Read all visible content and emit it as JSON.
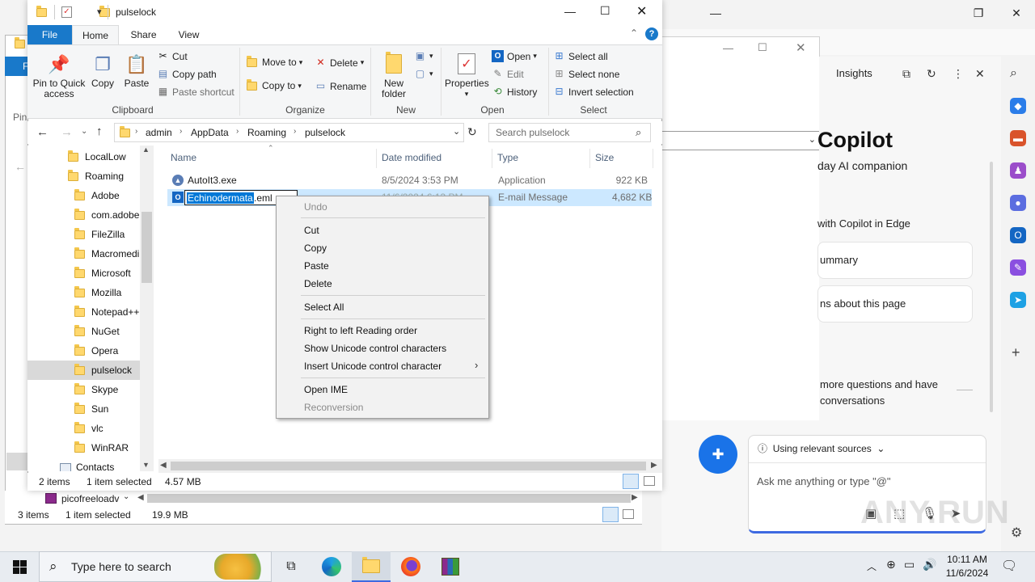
{
  "edge": {
    "copilot": {
      "tab_label": "Insights",
      "heading": "Copilot",
      "subheading": "day AI companion",
      "line1": "with Copilot in Edge",
      "card1": "ummary",
      "card2": "ns about this page",
      "more_line1": "more questions and have",
      "more_line2": "conversations",
      "sources_label": "Using relevant sources",
      "input_placeholder": "Ask me anything or type \"@\""
    }
  },
  "bg_window": {
    "status_items": "3 items",
    "status_selected": "1 item selected",
    "status_size": "19.9 MB",
    "nav_item": "picofreeloadv",
    "nav_left": "Pin",
    "ribbon_file": "F"
  },
  "explorer": {
    "title": "pulselock",
    "tabs": [
      "File",
      "Home",
      "Share",
      "View"
    ],
    "ribbon": {
      "clipboard": {
        "pin": "Pin to Quick access",
        "copy": "Copy",
        "paste": "Paste",
        "cut": "Cut",
        "copy_path": "Copy path",
        "paste_shortcut": "Paste shortcut",
        "label": "Clipboard"
      },
      "organize": {
        "move_to": "Move to",
        "copy_to": "Copy to",
        "delete": "Delete",
        "rename": "Rename",
        "label": "Organize"
      },
      "new": {
        "new_folder": "New folder",
        "label": "New"
      },
      "open": {
        "properties": "Properties",
        "open": "Open",
        "edit": "Edit",
        "history": "History",
        "label": "Open"
      },
      "select": {
        "select_all": "Select all",
        "select_none": "Select none",
        "invert": "Invert selection",
        "label": "Select"
      }
    },
    "breadcrumb": [
      "admin",
      "AppData",
      "Roaming",
      "pulselock"
    ],
    "search_placeholder": "Search pulselock",
    "nav_items": [
      "LocalLow",
      "Roaming",
      "Adobe",
      "com.adobe.",
      "FileZilla",
      "Macromedi",
      "Microsoft",
      "Mozilla",
      "Notepad++",
      "NuGet",
      "Opera",
      "pulselock",
      "Skype",
      "Sun",
      "vlc",
      "WinRAR",
      "Contacts"
    ],
    "columns": [
      "Name",
      "Date modified",
      "Type",
      "Size"
    ],
    "files": [
      {
        "name": "AutoIt3.exe",
        "date": "8/5/2024 3:53 PM",
        "type": "Application",
        "size": "922 KB"
      },
      {
        "name_selected": "Echinodermata",
        "name_ext": ".eml",
        "date": "11/6/2024 6:13 PM",
        "type": "E-mail Message",
        "size": "4,682 KB"
      }
    ],
    "status": {
      "items": "2 items",
      "selected": "1 item selected",
      "size": "4.57 MB"
    }
  },
  "context_menu": {
    "undo": "Undo",
    "cut": "Cut",
    "copy": "Copy",
    "paste": "Paste",
    "delete": "Delete",
    "select_all": "Select All",
    "rtl": "Right to left Reading order",
    "show_unicode": "Show Unicode control characters",
    "insert_unicode": "Insert Unicode control character",
    "open_ime": "Open IME",
    "reconversion": "Reconversion"
  },
  "taskbar": {
    "search_placeholder": "Type here to search",
    "time": "10:11 AM",
    "date": "11/6/2024"
  },
  "watermark": "ANY.RUN"
}
